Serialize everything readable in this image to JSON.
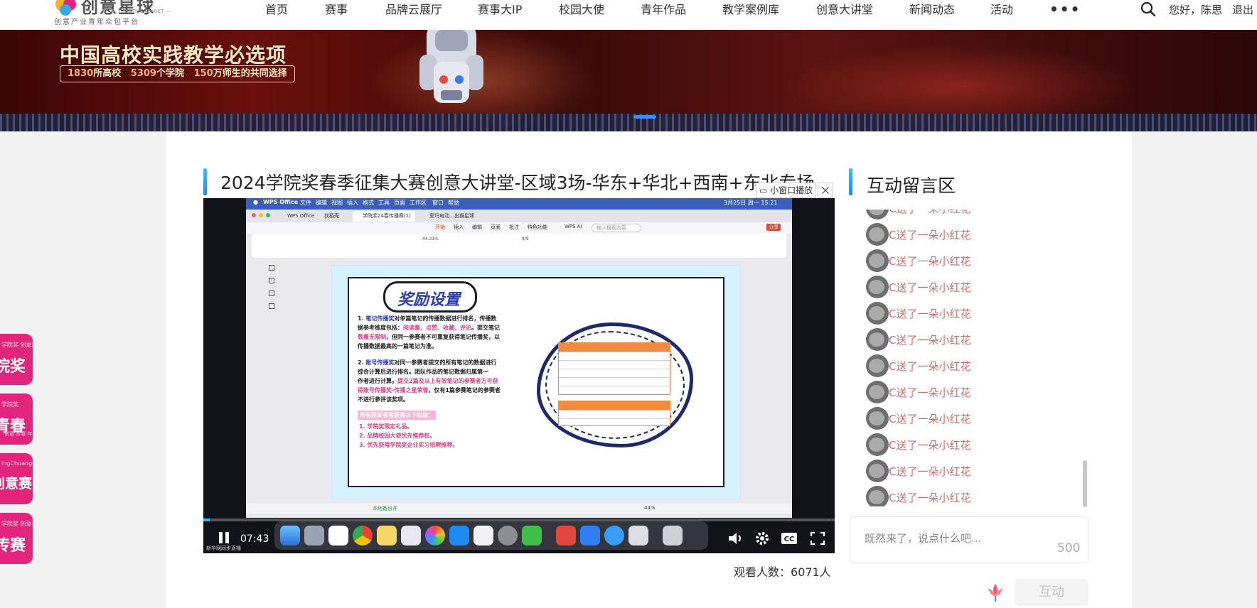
{
  "header": {
    "logo_name": "创意星球",
    "logo_en": "— CREATIVE PLANET —",
    "logo_sub": "创意产业青年众包平台",
    "nav": [
      "首页",
      "赛事",
      "品牌云展厅",
      "赛事大IP",
      "校园大使",
      "青年作品",
      "教学案例库",
      "创意大讲堂",
      "新闻动态",
      "活动"
    ],
    "more": "•••",
    "greeting": "您好，陈思",
    "logout": "退出"
  },
  "banner": {
    "title": "中国高校实践教学必选项",
    "stats": [
      {
        "num": "1830",
        "text": "所高校"
      },
      {
        "num": "5309",
        "text": "个学院"
      },
      {
        "num": "150",
        "text": "万师生的共同选择"
      }
    ]
  },
  "side_tabs": [
    {
      "small": "学院奖 创意星球",
      "big": "院奖",
      "tiny": ""
    },
    {
      "small": "学院奖",
      "big": "青春",
      "tiny": "创意 青春 年华"
    },
    {
      "small": "ingChuangsai",
      "big": "创意赛,",
      "tiny": ""
    },
    {
      "small": "学院奖 创意星球",
      "big": "传赛",
      "tiny": ""
    }
  ],
  "video": {
    "title": "2024学院奖春季征集大赛创意大讲堂-区域3场-华东+华北+西南+东北专场",
    "mini_window_label": "小窗口播放",
    "time": "07:43",
    "progress": 0.01,
    "viewers_label": "观看人数：",
    "viewers_count": "6071人",
    "watermark": "新华网同步直播",
    "screen": {
      "menubar": [
        "WPS Office",
        "文件",
        "编辑",
        "视图",
        "插入",
        "格式",
        "工具",
        "页面",
        "工作区",
        "窗口",
        "帮助"
      ],
      "menubar_right": "3月25日 周一 15:21",
      "tabs": [
        "WPS Office",
        "找稻壳",
        "学院奖24春传播赛(1)",
        "爱玛电动…出猴星球"
      ],
      "ribbon_tabs": [
        "开始",
        "插入",
        "编辑",
        "页面",
        "批注",
        "特色功能",
        "WPS AI"
      ],
      "search_placeholder": "输入搜索内容",
      "share": "分享",
      "zoom": "44.31%",
      "page": "8/9",
      "doc_title": "奖励设置",
      "para1_a": "1. ",
      "para1_b": "笔记传播奖",
      "para1_c": "对单篇笔记的传播数据进行排名，传播数",
      "para1_l2a": "据参考维度包括：",
      "para1_l2b": "阅读量、点赞、收藏、评论",
      "para1_l2c": "。提交笔记",
      "para1_l3a": "数量无限制",
      "para1_l3b": "，但同一参赛者不可重复获得笔记传播奖，以",
      "para1_l4": "传播数据最高的一篇笔记为准。",
      "para2_a": "2. ",
      "para2_b": "账号传播奖",
      "para2_c": "对同一参赛者提交的所有笔记的数据进行",
      "para2_l2": "综合计算后进行排名。团队作品的笔记数据归属第一",
      "para2_l3a": "作者进行计算。",
      "para2_l3b": "提交2篇及以上有效笔记的参赛者方可获",
      "para2_l4a": "得账号传播奖-传播之星荣誉",
      "para2_l4b": "，仅有1篇参赛笔记的参赛者",
      "para2_l5": "不进行参评该奖项。",
      "bonus_title": "所有获奖者将获得以下权益：",
      "bonus": [
        "1. 学院奖限定礼品。",
        "2. 品牌校园大使优先推荐权。",
        "3. 优先获得学院奖企业实习招聘推荐。"
      ],
      "status_left": "本地备份开",
      "status_zoom": "44%"
    }
  },
  "chat": {
    "title": "互动留言区",
    "messages": [
      "C送了一朵小红花",
      "C送了一朵小红花",
      "C送了一朵小红花",
      "C送了一朵小红花",
      "C送了一朵小红花",
      "C送了一朵小红花",
      "C送了一朵小红花",
      "C送了一朵小红花",
      "C送了一朵小红花",
      "C送了一朵小红花",
      "C送了一朵小红花",
      "C送了一朵小红花"
    ],
    "placeholder": "既然来了，说点什么吧...",
    "char_limit": "500",
    "interact_label": "互动"
  },
  "colors": {
    "accent_pink": "#e3247c",
    "accent_blue": "#2a84e0",
    "chat_text": "#d36b6b"
  }
}
